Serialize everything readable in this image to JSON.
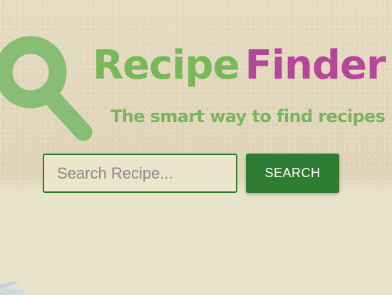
{
  "header": {
    "brand": {
      "part1": "Recipe",
      "part2": "Finder"
    },
    "tagline": "The smart way to find recipes",
    "icon": "magnifying-glass-icon"
  },
  "search": {
    "placeholder": "Search Recipe...",
    "value": "",
    "button_label": "SEARCH"
  },
  "colors": {
    "brand_green": "#78b85a",
    "brand_magenta": "#b4479a",
    "button_green": "#2e7d32",
    "background": "#e9e3cb"
  }
}
